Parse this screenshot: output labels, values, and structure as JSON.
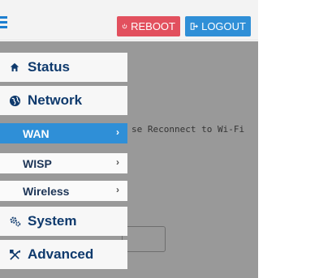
{
  "header": {
    "reboot_label": "REBOOT",
    "logout_label": "LOGOUT",
    "accent_blue": "#2f8fd7",
    "reboot_red": "#e2505e"
  },
  "overlay": {
    "message": "se Reconnect to Wi-Fi"
  },
  "menu": {
    "items": [
      {
        "label": "Status",
        "icon": "home-icon"
      },
      {
        "label": "Network",
        "icon": "globe-icon"
      },
      {
        "label": "WAN",
        "chevron": "›",
        "active": true
      },
      {
        "label": "WISP",
        "chevron": "›"
      },
      {
        "label": "Wireless",
        "chevron": "›"
      },
      {
        "label": "System",
        "icon": "gears-icon"
      },
      {
        "label": "Advanced",
        "icon": "tools-icon"
      }
    ]
  }
}
